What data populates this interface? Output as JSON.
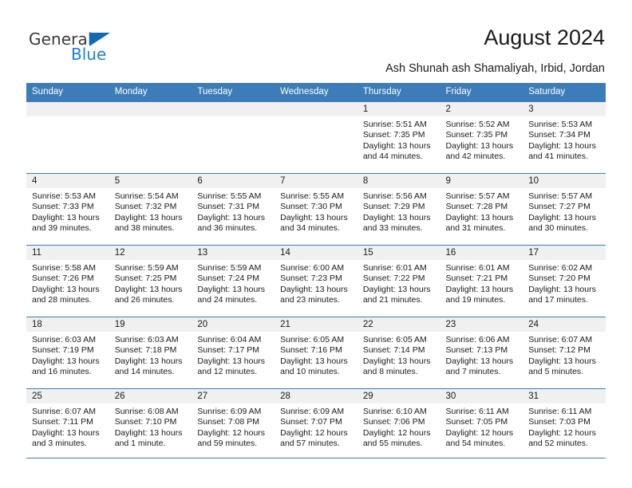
{
  "brand": {
    "name_part1": "General",
    "name_part2": "Blue",
    "triangle_icon": "triangle-icon",
    "colors": {
      "general_text": "#3a3a3a",
      "blue_text": "#1a7fd4",
      "triangle": "#1268b3"
    }
  },
  "header": {
    "title": "August 2024",
    "subtitle": "Ash Shunah ash Shamaliyah, Irbid, Jordan"
  },
  "theme": {
    "header_bg": "#3c7cb8",
    "header_text": "#ffffff",
    "daynum_band_bg": "#f0f0f0",
    "cell_bg": "#ffffff",
    "rule": "#3c7cb8"
  },
  "weekday_headers": [
    "Sunday",
    "Monday",
    "Tuesday",
    "Wednesday",
    "Thursday",
    "Friday",
    "Saturday"
  ],
  "weeks": [
    [
      {
        "day": "",
        "empty": true,
        "sunrise": "",
        "sunset": "",
        "daylight_line1": "",
        "daylight_line2": ""
      },
      {
        "day": "",
        "empty": true,
        "sunrise": "",
        "sunset": "",
        "daylight_line1": "",
        "daylight_line2": ""
      },
      {
        "day": "",
        "empty": true,
        "sunrise": "",
        "sunset": "",
        "daylight_line1": "",
        "daylight_line2": ""
      },
      {
        "day": "",
        "empty": true,
        "sunrise": "",
        "sunset": "",
        "daylight_line1": "",
        "daylight_line2": ""
      },
      {
        "day": "1",
        "empty": false,
        "sunrise": "Sunrise: 5:51 AM",
        "sunset": "Sunset: 7:35 PM",
        "daylight_line1": "Daylight: 13 hours",
        "daylight_line2": "and 44 minutes."
      },
      {
        "day": "2",
        "empty": false,
        "sunrise": "Sunrise: 5:52 AM",
        "sunset": "Sunset: 7:35 PM",
        "daylight_line1": "Daylight: 13 hours",
        "daylight_line2": "and 42 minutes."
      },
      {
        "day": "3",
        "empty": false,
        "sunrise": "Sunrise: 5:53 AM",
        "sunset": "Sunset: 7:34 PM",
        "daylight_line1": "Daylight: 13 hours",
        "daylight_line2": "and 41 minutes."
      }
    ],
    [
      {
        "day": "4",
        "empty": false,
        "sunrise": "Sunrise: 5:53 AM",
        "sunset": "Sunset: 7:33 PM",
        "daylight_line1": "Daylight: 13 hours",
        "daylight_line2": "and 39 minutes."
      },
      {
        "day": "5",
        "empty": false,
        "sunrise": "Sunrise: 5:54 AM",
        "sunset": "Sunset: 7:32 PM",
        "daylight_line1": "Daylight: 13 hours",
        "daylight_line2": "and 38 minutes."
      },
      {
        "day": "6",
        "empty": false,
        "sunrise": "Sunrise: 5:55 AM",
        "sunset": "Sunset: 7:31 PM",
        "daylight_line1": "Daylight: 13 hours",
        "daylight_line2": "and 36 minutes."
      },
      {
        "day": "7",
        "empty": false,
        "sunrise": "Sunrise: 5:55 AM",
        "sunset": "Sunset: 7:30 PM",
        "daylight_line1": "Daylight: 13 hours",
        "daylight_line2": "and 34 minutes."
      },
      {
        "day": "8",
        "empty": false,
        "sunrise": "Sunrise: 5:56 AM",
        "sunset": "Sunset: 7:29 PM",
        "daylight_line1": "Daylight: 13 hours",
        "daylight_line2": "and 33 minutes."
      },
      {
        "day": "9",
        "empty": false,
        "sunrise": "Sunrise: 5:57 AM",
        "sunset": "Sunset: 7:28 PM",
        "daylight_line1": "Daylight: 13 hours",
        "daylight_line2": "and 31 minutes."
      },
      {
        "day": "10",
        "empty": false,
        "sunrise": "Sunrise: 5:57 AM",
        "sunset": "Sunset: 7:27 PM",
        "daylight_line1": "Daylight: 13 hours",
        "daylight_line2": "and 30 minutes."
      }
    ],
    [
      {
        "day": "11",
        "empty": false,
        "sunrise": "Sunrise: 5:58 AM",
        "sunset": "Sunset: 7:26 PM",
        "daylight_line1": "Daylight: 13 hours",
        "daylight_line2": "and 28 minutes."
      },
      {
        "day": "12",
        "empty": false,
        "sunrise": "Sunrise: 5:59 AM",
        "sunset": "Sunset: 7:25 PM",
        "daylight_line1": "Daylight: 13 hours",
        "daylight_line2": "and 26 minutes."
      },
      {
        "day": "13",
        "empty": false,
        "sunrise": "Sunrise: 5:59 AM",
        "sunset": "Sunset: 7:24 PM",
        "daylight_line1": "Daylight: 13 hours",
        "daylight_line2": "and 24 minutes."
      },
      {
        "day": "14",
        "empty": false,
        "sunrise": "Sunrise: 6:00 AM",
        "sunset": "Sunset: 7:23 PM",
        "daylight_line1": "Daylight: 13 hours",
        "daylight_line2": "and 23 minutes."
      },
      {
        "day": "15",
        "empty": false,
        "sunrise": "Sunrise: 6:01 AM",
        "sunset": "Sunset: 7:22 PM",
        "daylight_line1": "Daylight: 13 hours",
        "daylight_line2": "and 21 minutes."
      },
      {
        "day": "16",
        "empty": false,
        "sunrise": "Sunrise: 6:01 AM",
        "sunset": "Sunset: 7:21 PM",
        "daylight_line1": "Daylight: 13 hours",
        "daylight_line2": "and 19 minutes."
      },
      {
        "day": "17",
        "empty": false,
        "sunrise": "Sunrise: 6:02 AM",
        "sunset": "Sunset: 7:20 PM",
        "daylight_line1": "Daylight: 13 hours",
        "daylight_line2": "and 17 minutes."
      }
    ],
    [
      {
        "day": "18",
        "empty": false,
        "sunrise": "Sunrise: 6:03 AM",
        "sunset": "Sunset: 7:19 PM",
        "daylight_line1": "Daylight: 13 hours",
        "daylight_line2": "and 16 minutes."
      },
      {
        "day": "19",
        "empty": false,
        "sunrise": "Sunrise: 6:03 AM",
        "sunset": "Sunset: 7:18 PM",
        "daylight_line1": "Daylight: 13 hours",
        "daylight_line2": "and 14 minutes."
      },
      {
        "day": "20",
        "empty": false,
        "sunrise": "Sunrise: 6:04 AM",
        "sunset": "Sunset: 7:17 PM",
        "daylight_line1": "Daylight: 13 hours",
        "daylight_line2": "and 12 minutes."
      },
      {
        "day": "21",
        "empty": false,
        "sunrise": "Sunrise: 6:05 AM",
        "sunset": "Sunset: 7:16 PM",
        "daylight_line1": "Daylight: 13 hours",
        "daylight_line2": "and 10 minutes."
      },
      {
        "day": "22",
        "empty": false,
        "sunrise": "Sunrise: 6:05 AM",
        "sunset": "Sunset: 7:14 PM",
        "daylight_line1": "Daylight: 13 hours",
        "daylight_line2": "and 8 minutes."
      },
      {
        "day": "23",
        "empty": false,
        "sunrise": "Sunrise: 6:06 AM",
        "sunset": "Sunset: 7:13 PM",
        "daylight_line1": "Daylight: 13 hours",
        "daylight_line2": "and 7 minutes."
      },
      {
        "day": "24",
        "empty": false,
        "sunrise": "Sunrise: 6:07 AM",
        "sunset": "Sunset: 7:12 PM",
        "daylight_line1": "Daylight: 13 hours",
        "daylight_line2": "and 5 minutes."
      }
    ],
    [
      {
        "day": "25",
        "empty": false,
        "sunrise": "Sunrise: 6:07 AM",
        "sunset": "Sunset: 7:11 PM",
        "daylight_line1": "Daylight: 13 hours",
        "daylight_line2": "and 3 minutes."
      },
      {
        "day": "26",
        "empty": false,
        "sunrise": "Sunrise: 6:08 AM",
        "sunset": "Sunset: 7:10 PM",
        "daylight_line1": "Daylight: 13 hours",
        "daylight_line2": "and 1 minute."
      },
      {
        "day": "27",
        "empty": false,
        "sunrise": "Sunrise: 6:09 AM",
        "sunset": "Sunset: 7:08 PM",
        "daylight_line1": "Daylight: 12 hours",
        "daylight_line2": "and 59 minutes."
      },
      {
        "day": "28",
        "empty": false,
        "sunrise": "Sunrise: 6:09 AM",
        "sunset": "Sunset: 7:07 PM",
        "daylight_line1": "Daylight: 12 hours",
        "daylight_line2": "and 57 minutes."
      },
      {
        "day": "29",
        "empty": false,
        "sunrise": "Sunrise: 6:10 AM",
        "sunset": "Sunset: 7:06 PM",
        "daylight_line1": "Daylight: 12 hours",
        "daylight_line2": "and 55 minutes."
      },
      {
        "day": "30",
        "empty": false,
        "sunrise": "Sunrise: 6:11 AM",
        "sunset": "Sunset: 7:05 PM",
        "daylight_line1": "Daylight: 12 hours",
        "daylight_line2": "and 54 minutes."
      },
      {
        "day": "31",
        "empty": false,
        "sunrise": "Sunrise: 6:11 AM",
        "sunset": "Sunset: 7:03 PM",
        "daylight_line1": "Daylight: 12 hours",
        "daylight_line2": "and 52 minutes."
      }
    ]
  ]
}
